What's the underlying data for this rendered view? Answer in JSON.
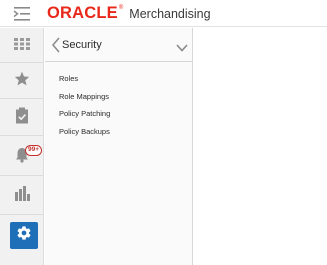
{
  "header": {
    "brand_logo": "ORACLE",
    "brand_reg": "®",
    "app_name": "Merchandising"
  },
  "rail": {
    "items": [
      {
        "icon": "apps-grid-icon"
      },
      {
        "icon": "star-icon"
      },
      {
        "icon": "task-clipboard-icon"
      },
      {
        "icon": "bell-icon",
        "badge": "99+"
      },
      {
        "icon": "bar-chart-icon"
      },
      {
        "icon": "gear-icon",
        "active": true
      }
    ]
  },
  "panel": {
    "title": "Security",
    "items": [
      {
        "label": "Roles"
      },
      {
        "label": "Role Mappings"
      },
      {
        "label": "Policy Patching"
      },
      {
        "label": "Policy Backups"
      }
    ]
  },
  "colors": {
    "brand_red": "#e8281b",
    "active_blue": "#1f6fb8",
    "badge_red": "#c4302b",
    "rail_bg": "#f1f1f1"
  }
}
